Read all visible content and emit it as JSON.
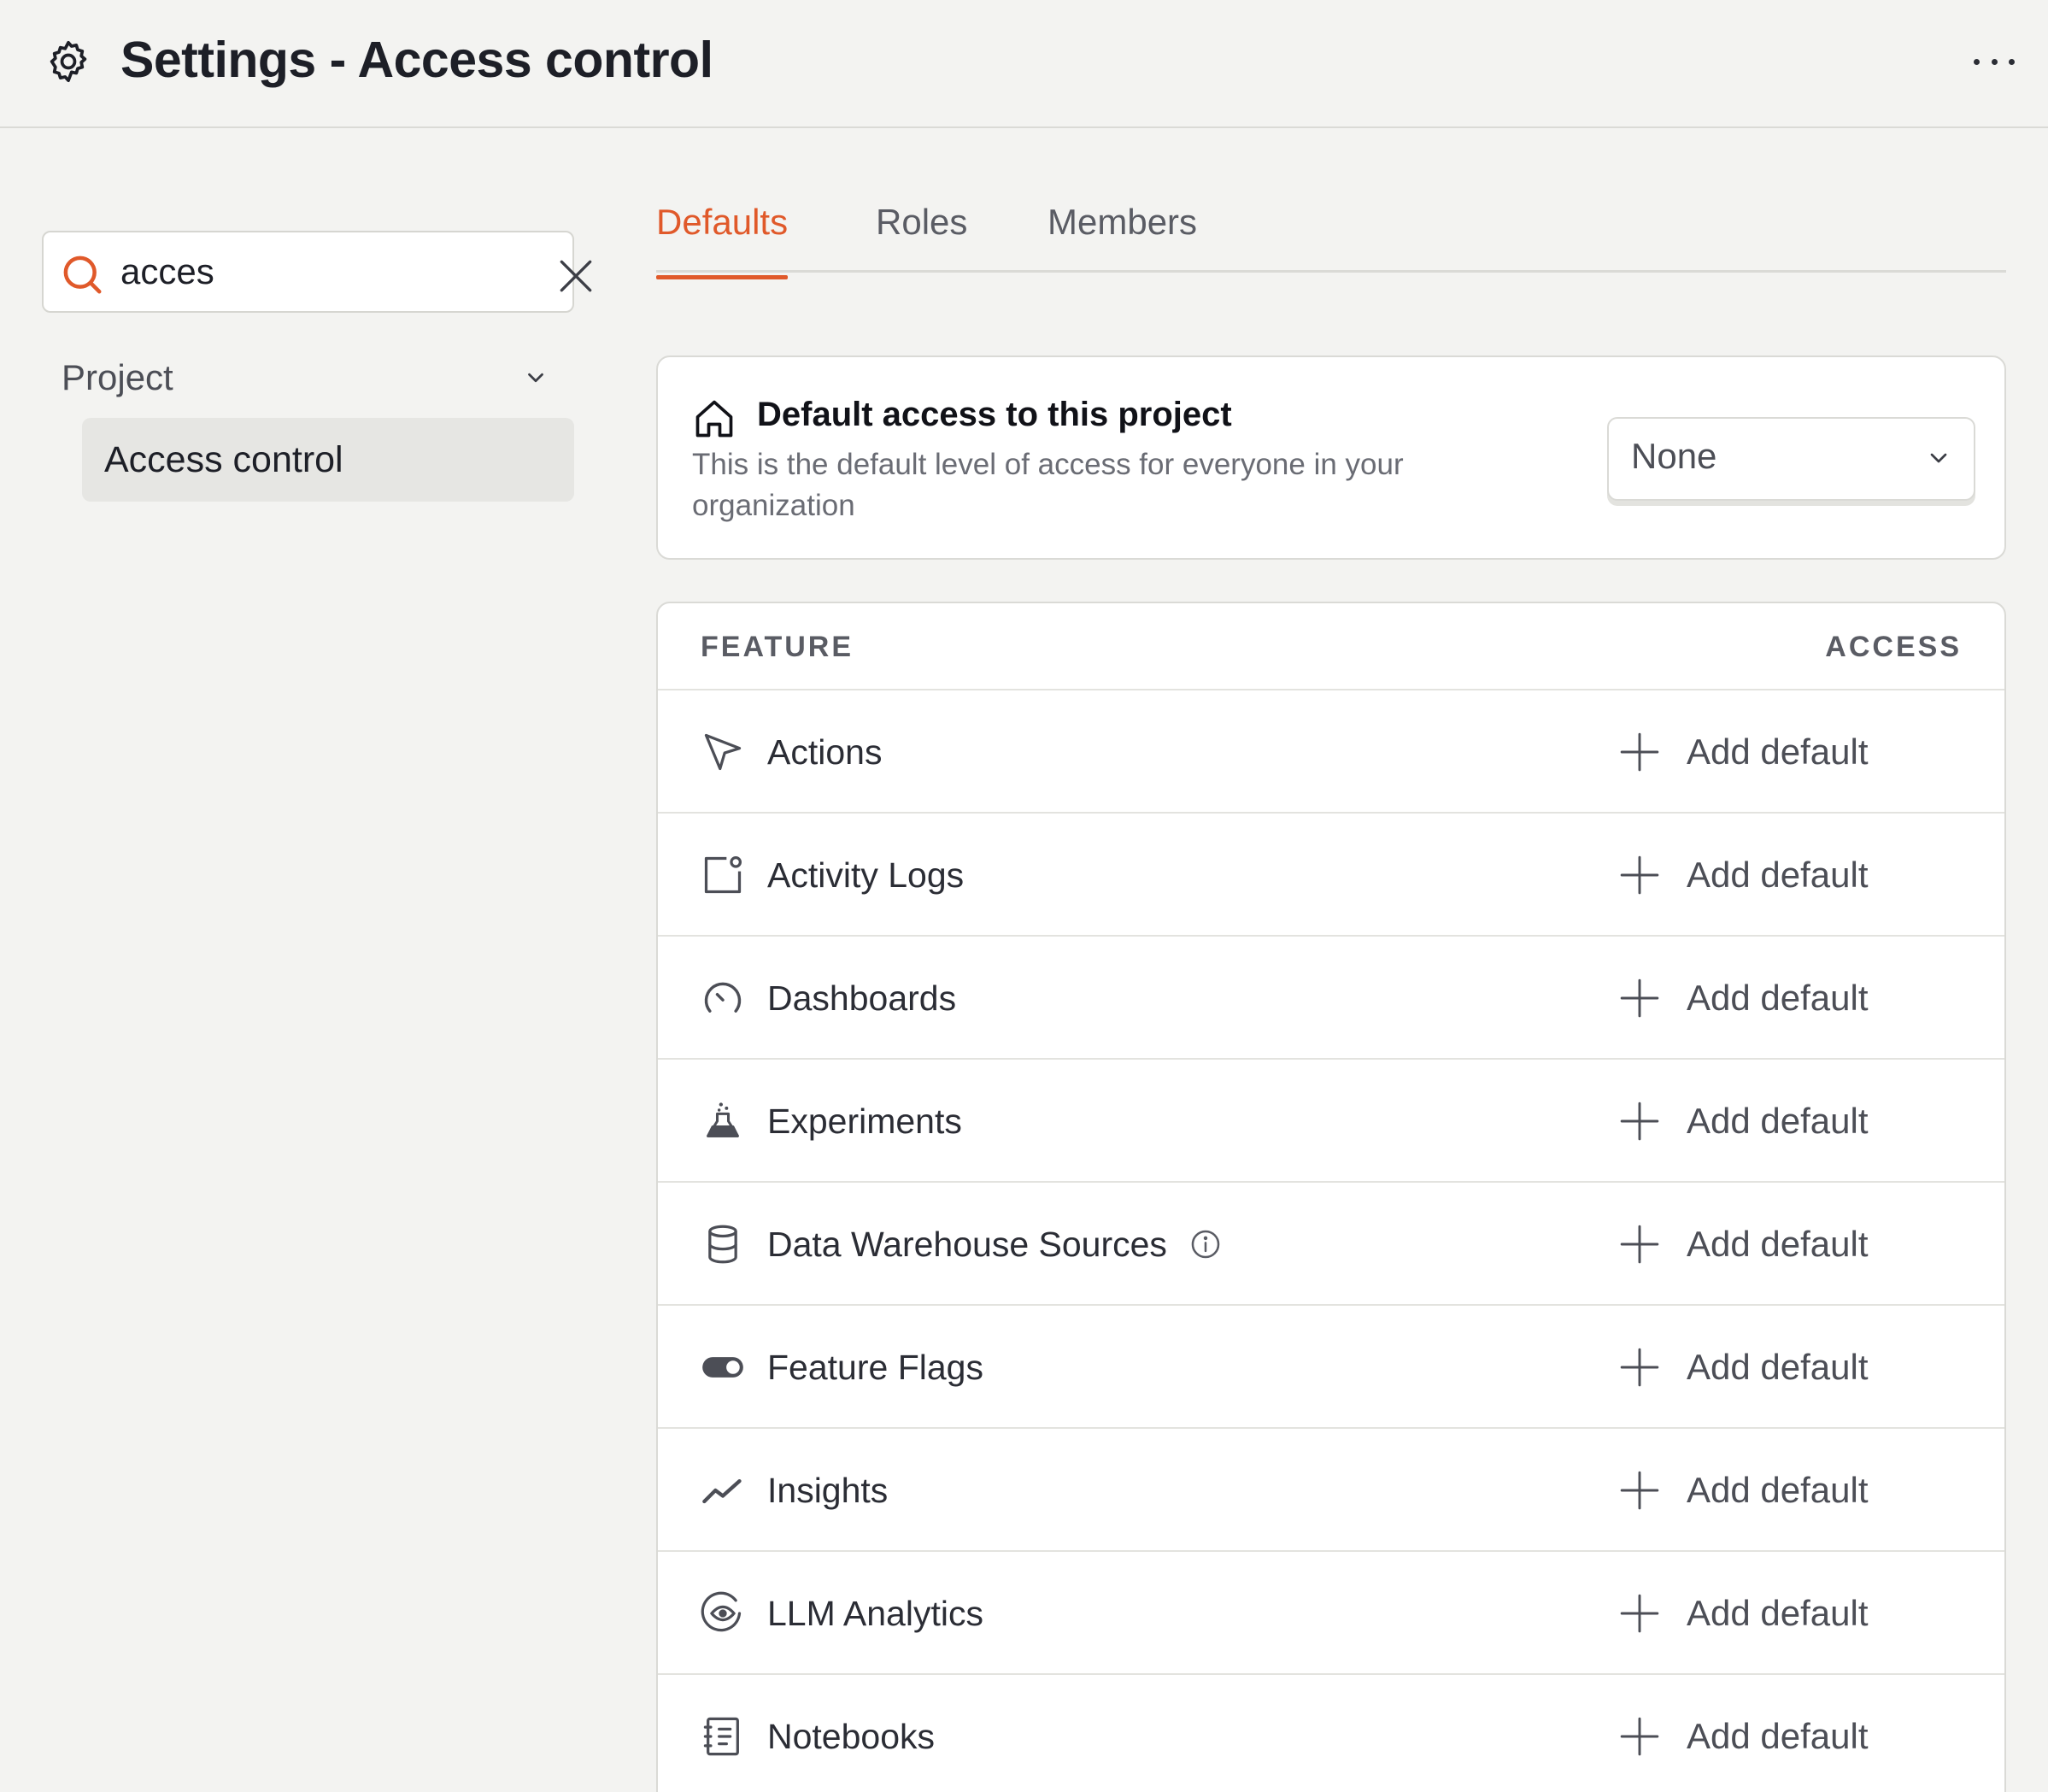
{
  "header": {
    "title": "Settings - Access control",
    "icon": "gear-icon",
    "more_icon": "more-horizontal-icon"
  },
  "sidebar": {
    "search": {
      "value": "acces",
      "placeholder": "",
      "icon": "search-icon",
      "clear_icon": "close-icon"
    },
    "group": {
      "label": "Project",
      "icon": "chevron-down-icon"
    },
    "items": [
      {
        "label": "Access control",
        "selected": true
      }
    ]
  },
  "tabs": [
    {
      "label": "Defaults",
      "active": true
    },
    {
      "label": "Roles",
      "active": false
    },
    {
      "label": "Members",
      "active": false
    }
  ],
  "default_access": {
    "title": "Default access to this project",
    "description": "This is the default level of access for everyone in your organization",
    "icon": "home-icon",
    "select_value": "None"
  },
  "table": {
    "headers": {
      "feature": "FEATURE",
      "access": "ACCESS"
    },
    "rows": [
      {
        "feature": "Actions",
        "icon": "cursor-pointer-icon",
        "action": "Add default"
      },
      {
        "feature": "Activity Logs",
        "icon": "activity-log-icon",
        "action": "Add default"
      },
      {
        "feature": "Dashboards",
        "icon": "gauge-icon",
        "action": "Add default"
      },
      {
        "feature": "Experiments",
        "icon": "flask-icon",
        "action": "Add default"
      },
      {
        "feature": "Data Warehouse Sources",
        "icon": "database-icon",
        "action": "Add default",
        "info": true
      },
      {
        "feature": "Feature Flags",
        "icon": "toggle-icon",
        "action": "Add default"
      },
      {
        "feature": "Insights",
        "icon": "trend-line-icon",
        "action": "Add default"
      },
      {
        "feature": "LLM Analytics",
        "icon": "ai-eye-icon",
        "action": "Add default"
      },
      {
        "feature": "Notebooks",
        "icon": "notebook-icon",
        "action": "Add default"
      }
    ]
  },
  "colors": {
    "accent": "#e0592a",
    "background": "#f3f3f1",
    "surface": "#ffffff",
    "border": "#dadad6",
    "text": "#1d1f27",
    "muted": "#5a5c64"
  }
}
